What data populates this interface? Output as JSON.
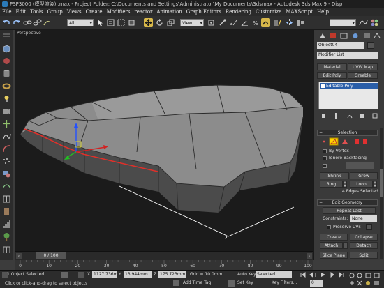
{
  "window": {
    "title": "PSP3000 (模型渲染) .max - Project Folder: C:\\Documents and Settings\\Administrator\\My Documents\\3dsmax - Autodesk 3ds Max 9 - Disp"
  },
  "menu": [
    "File",
    "Edit",
    "Tools",
    "Group",
    "Views",
    "Create",
    "Modifiers",
    "reactor",
    "Animation",
    "Graph Editors",
    "Rendering",
    "Customize",
    "MAXScript",
    "Help"
  ],
  "toolbar": {
    "selection_filter": "All",
    "reference_coord": "View",
    "named_selection": ""
  },
  "viewport": {
    "label": "Perspective"
  },
  "command_panel": {
    "object_name": "Object04",
    "modifier_list": "Modifier List",
    "modifier_buttons": [
      "Material",
      "UVW Map",
      "Edit Poly",
      "Greeble"
    ],
    "stack_item": "Editable Poly",
    "selection": {
      "title": "Selection",
      "by_vertex": "By Vertex",
      "ignore_backfacing": "Ignore Backfacing",
      "shrink": "Shrink",
      "grow": "Grow",
      "ring": "Ring",
      "loop": "Loop",
      "status": "4 Edges Selected"
    },
    "edit_geometry": {
      "title": "Edit Geometry",
      "repeat_last": "Repeat Last",
      "constraints_label": "Constraints:",
      "constraints_value": "None",
      "preserve_uvs": "Preserve UVs",
      "create": "Create",
      "collapse": "Collapse",
      "attach": "Attach",
      "detach": "Detach",
      "slice_plane": "Slice Plane",
      "split": "Split"
    }
  },
  "time_slider": {
    "frame_label": "0 / 100",
    "ticks": [
      "0",
      "10",
      "20",
      "30",
      "40",
      "50",
      "60",
      "70",
      "80",
      "90",
      "100"
    ]
  },
  "status": {
    "selection_info": "1 Object Selected",
    "prompt": "Click or click-and-drag to select objects",
    "x_label": "X",
    "x_value": "1127.736m",
    "y_label": "Y",
    "y_value": "13.944mm",
    "z_label": "Z",
    "z_value": "175.723mm",
    "grid": "Grid = 10.0mm",
    "add_time_tag": "Add Time Tag",
    "auto_key": "Auto Key",
    "auto_key_value": "Selected",
    "set_key": "Set Key",
    "key_filters": "Key Filters...",
    "frame": "0"
  },
  "colors": {
    "selected_edge": "#e0302a",
    "gizmo_x": "#d22222",
    "gizmo_y": "#22c022",
    "gizmo_z": "#2250ff",
    "modifier_stack_bg": "#2a5ea8",
    "subobject_active": "#ffd400"
  }
}
